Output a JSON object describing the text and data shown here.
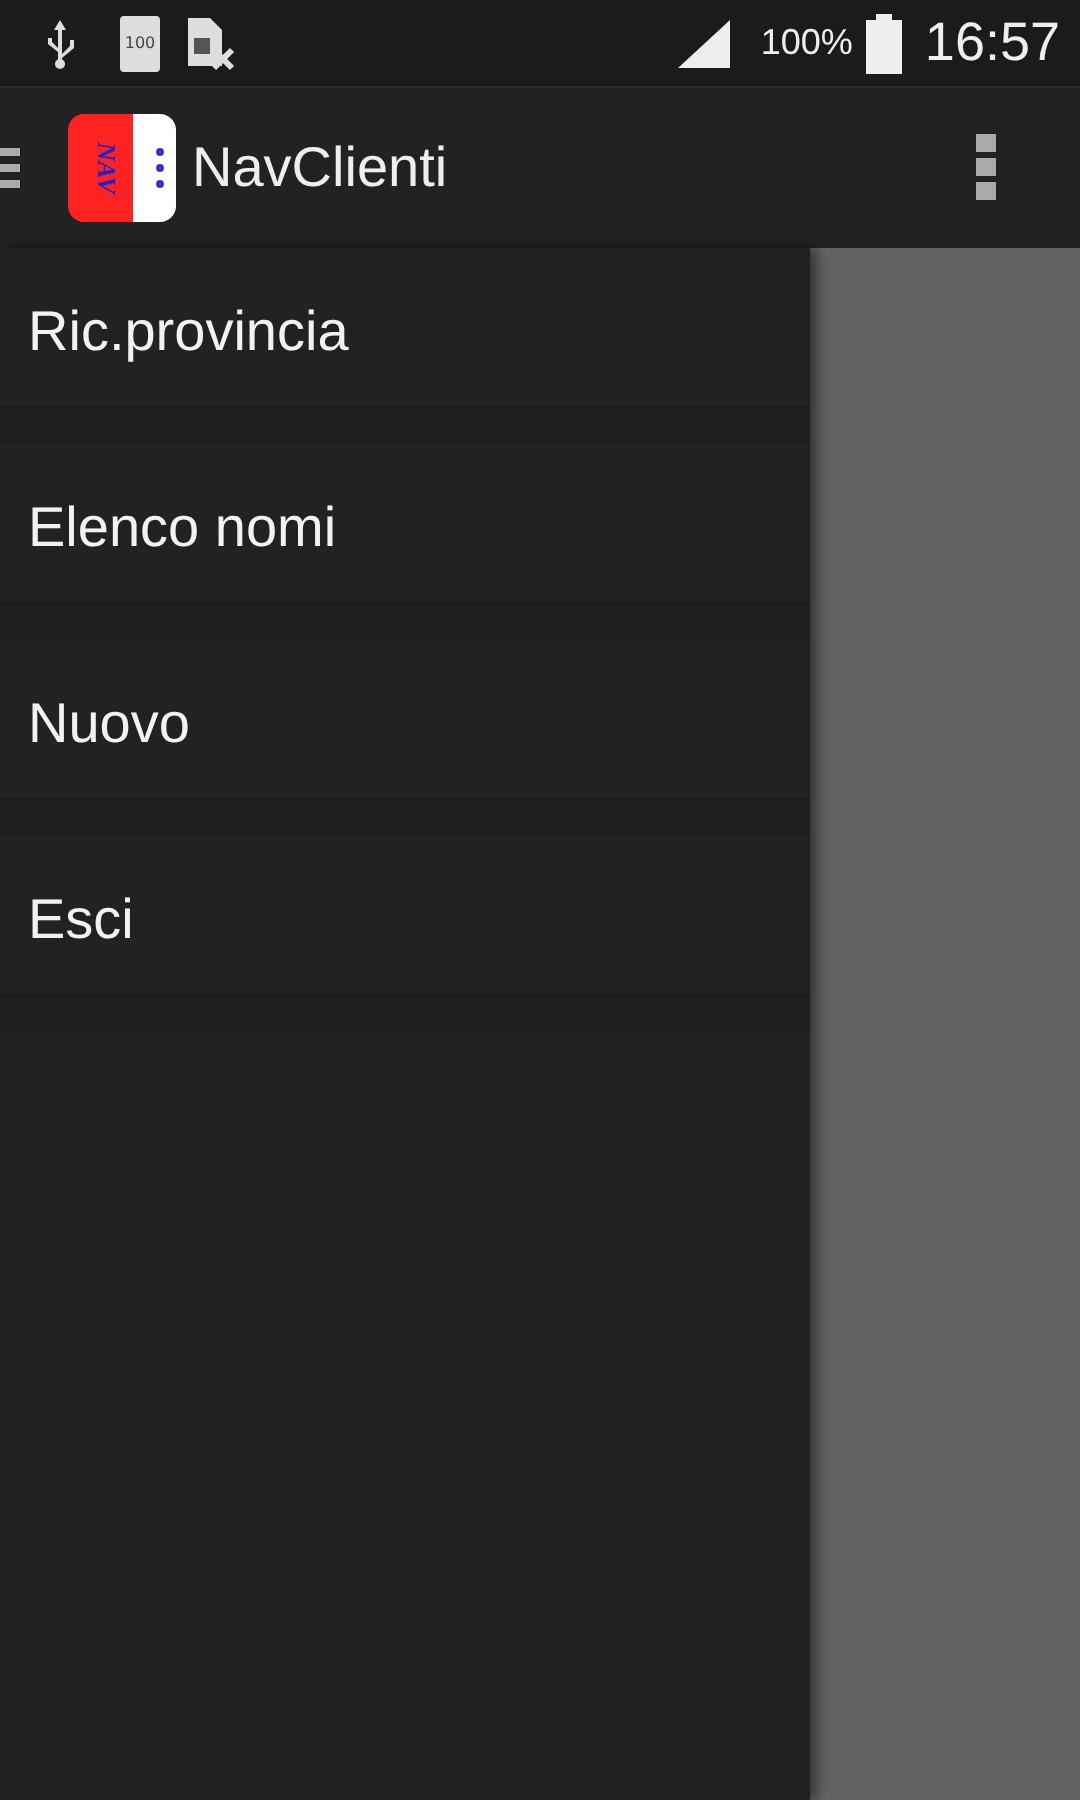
{
  "status_bar": {
    "battery_badge": "100",
    "battery_percent": "100%",
    "time": "16:57"
  },
  "app_bar": {
    "logo_text": "NAV",
    "title": "NavClienti"
  },
  "drawer": {
    "items": [
      {
        "label": "Ric.provincia"
      },
      {
        "label": "Elenco nomi"
      },
      {
        "label": "Nuovo"
      },
      {
        "label": "Esci"
      }
    ]
  }
}
